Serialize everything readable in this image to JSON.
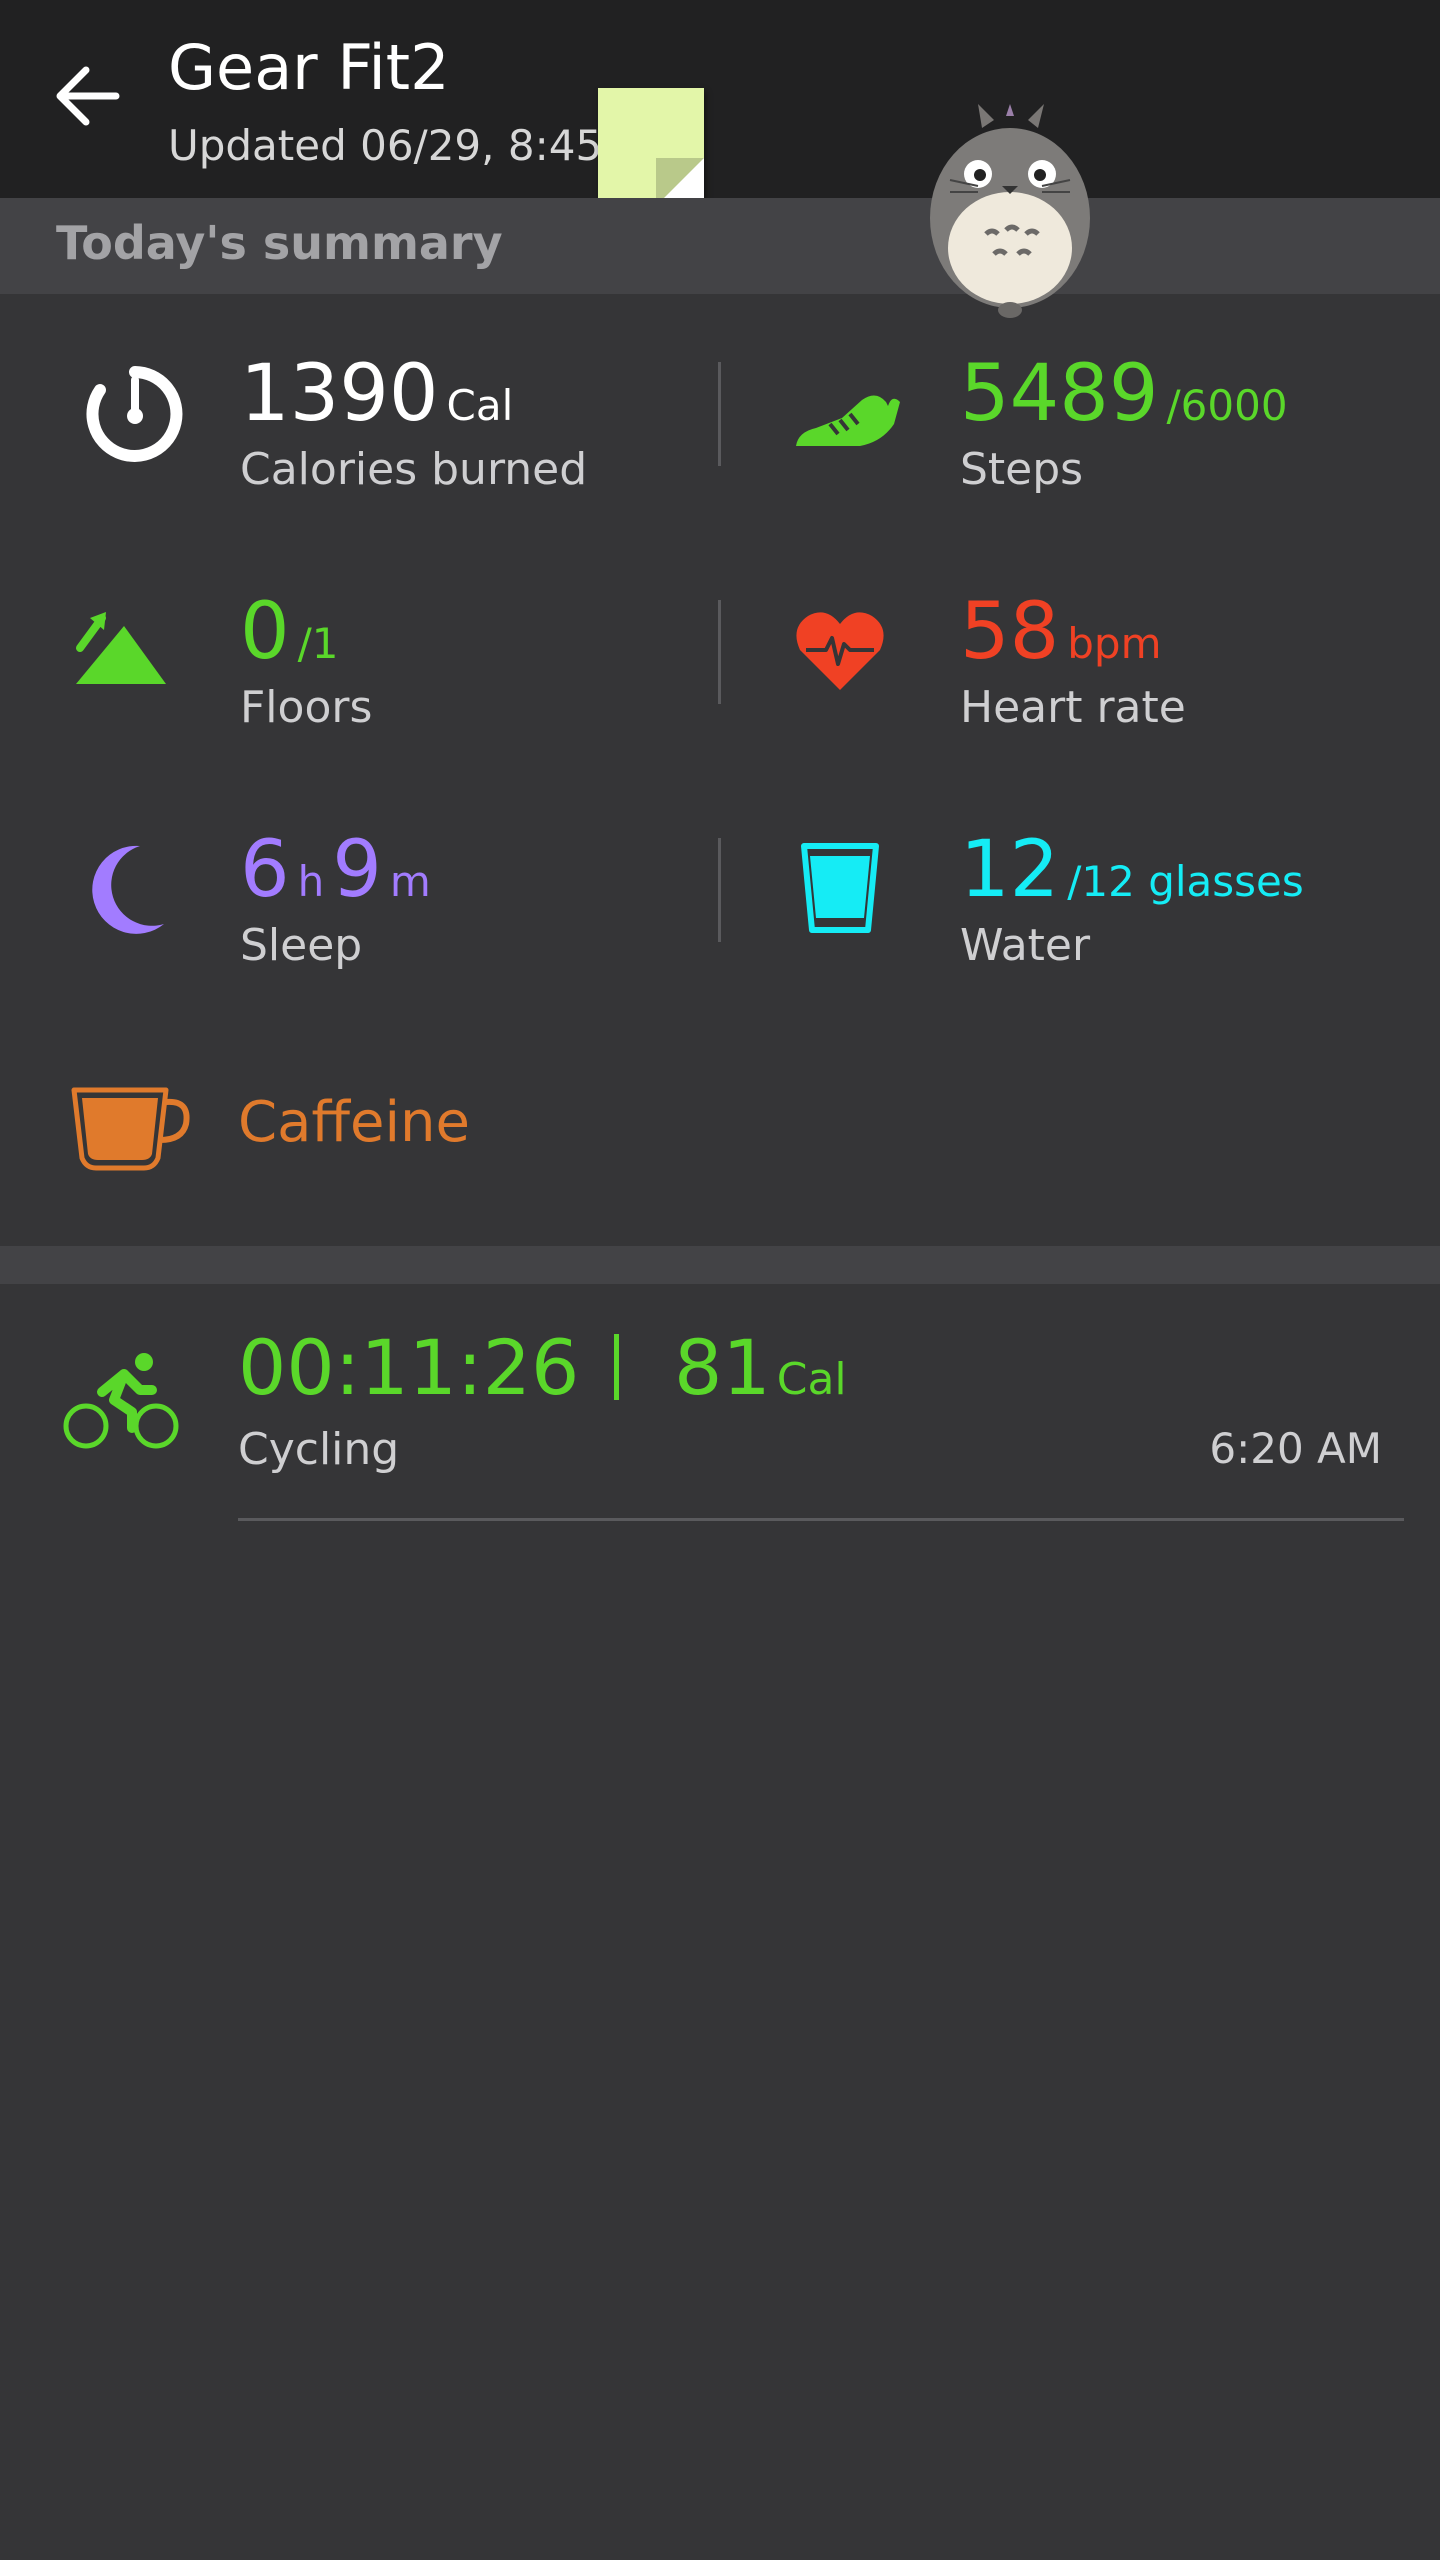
{
  "appbar": {
    "title": "Gear Fit2",
    "subtitle": "Updated 06/29, 8:45"
  },
  "section": {
    "title": "Today's summary"
  },
  "colors": {
    "green": "#5ad72a",
    "red": "#f04124",
    "purple": "#a27cff",
    "cyan": "#15ecf5",
    "orange": "#e07a2c",
    "white": "#ffffff"
  },
  "tiles": {
    "calories": {
      "value": "1390",
      "unit": "Cal",
      "label": "Calories burned",
      "icon": "timer-icon"
    },
    "steps": {
      "value": "5489",
      "unit": "/6000",
      "label": "Steps",
      "icon": "shoe-icon"
    },
    "floors": {
      "value": "0",
      "unit": "/1",
      "label": "Floors",
      "icon": "mountain-up-icon"
    },
    "heart": {
      "value": "58",
      "unit": "bpm",
      "label": "Heart rate",
      "icon": "heart-rate-icon"
    },
    "sleep": {
      "hours": "6",
      "h_unit": "h",
      "minutes": "9",
      "m_unit": "m",
      "label": "Sleep",
      "icon": "moon-icon"
    },
    "water": {
      "value": "12",
      "unit": "/12 glasses",
      "label": "Water",
      "icon": "glass-icon"
    },
    "caffeine": {
      "label": "Caffeine",
      "icon": "cup-icon"
    }
  },
  "workout": {
    "duration": "00:11:26",
    "calories": "81",
    "unit": "Cal",
    "name": "Cycling",
    "time": "6:20 AM",
    "icon": "cycling-icon"
  }
}
